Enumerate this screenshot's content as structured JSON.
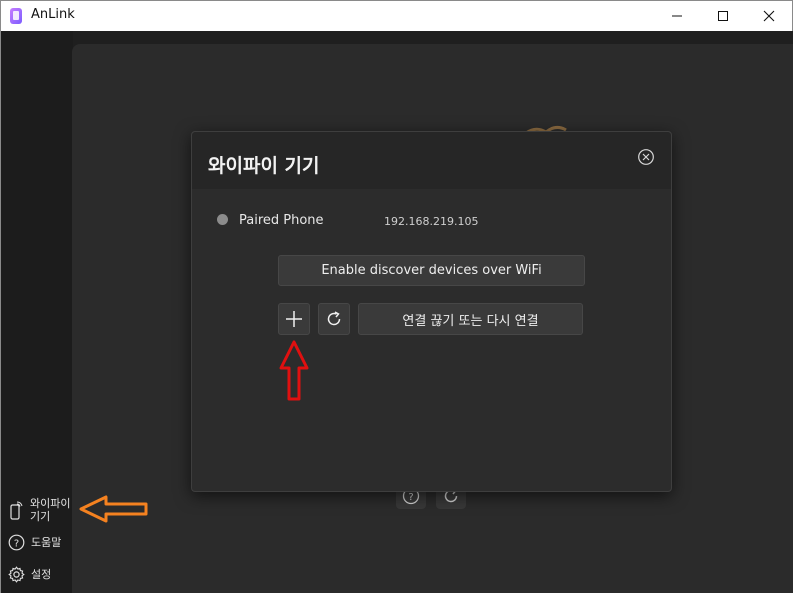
{
  "window": {
    "title": "AnLink",
    "minimize_glyph": "—",
    "maximize_glyph": "☐",
    "close_glyph": "✕"
  },
  "sidebar": {
    "items": [
      {
        "label": "와이파이 기기",
        "icon": "phone-wifi-icon"
      },
      {
        "label": "도움말",
        "icon": "help-icon"
      },
      {
        "label": "설정",
        "icon": "gear-icon"
      }
    ]
  },
  "modal": {
    "title": "와이파이 기기",
    "devices": [
      {
        "name": "Paired Phone",
        "ip": "192.168.219.105",
        "status_color": "#8c8c8c"
      }
    ],
    "discover_button": "Enable discover devices over WiFi",
    "add_icon": "plus-icon",
    "refresh_icon": "refresh-icon",
    "reconnect_button": "연결 끊기 또는 다시 연결"
  },
  "annotations": {
    "red_arrow_color": "#e01010",
    "orange_arrow_color": "#f58220"
  },
  "colors": {
    "background": "#1f1f1f",
    "panel": "#2b2b2b",
    "modal": "#2c2c2c",
    "button": "#3a3a3a"
  }
}
